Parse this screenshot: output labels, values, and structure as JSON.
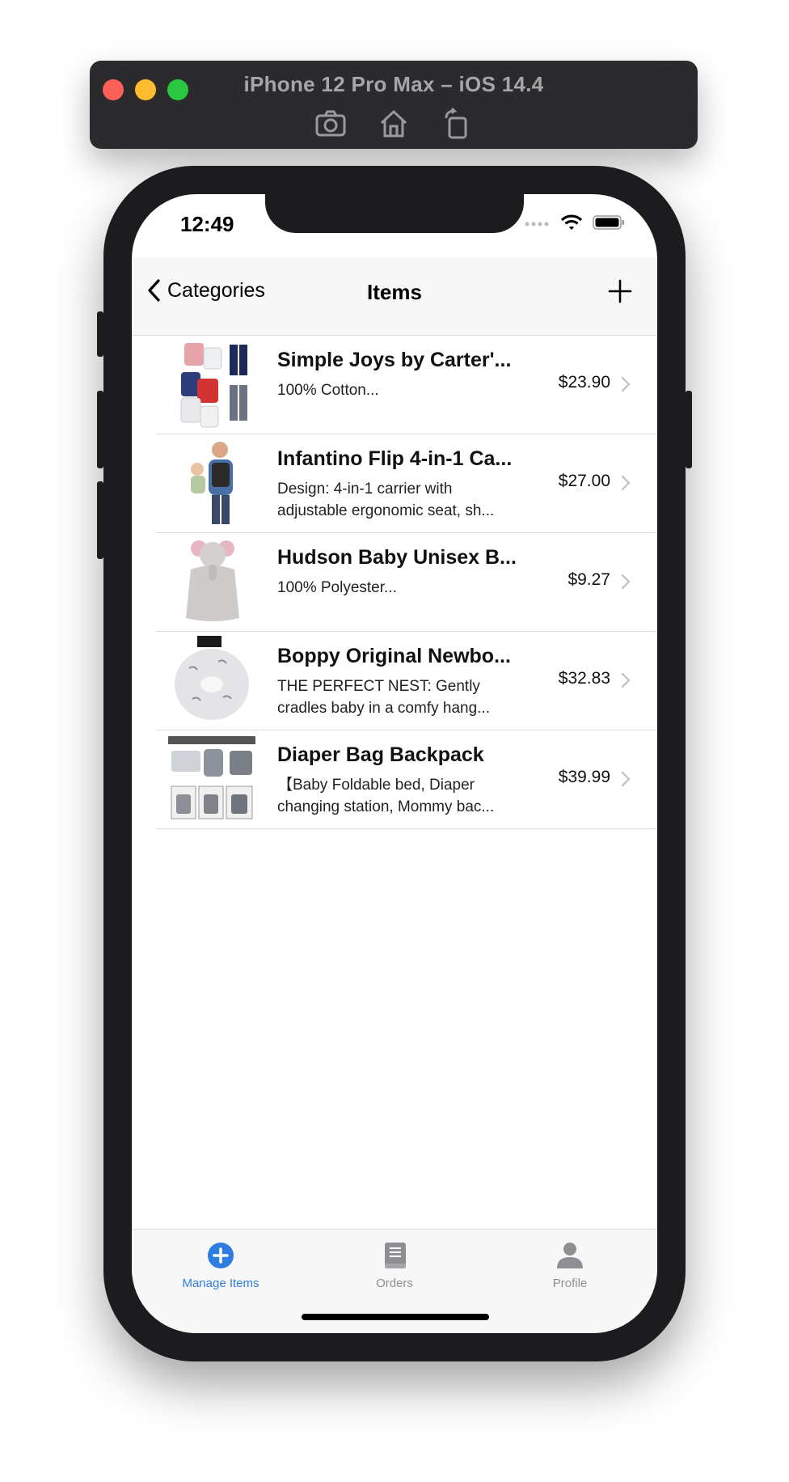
{
  "simulator": {
    "title": "iPhone 12 Pro Max – iOS 14.4",
    "tools": [
      {
        "icon": "screenshot-icon"
      },
      {
        "icon": "home-icon"
      },
      {
        "icon": "rotate-icon"
      }
    ]
  },
  "status_bar": {
    "time": "12:49"
  },
  "nav": {
    "back_label": "Categories",
    "title": "Items",
    "add_icon": "plus-icon"
  },
  "items": [
    {
      "title": "Simple Joys by Carter'...",
      "subtitle": "100% Cotton...",
      "price": "$23.90"
    },
    {
      "title": "Infantino Flip 4-in-1 Ca...",
      "subtitle": "Design: 4-in-1 carrier with adjustable ergonomic seat, sh...",
      "price": "$27.00"
    },
    {
      "title": "Hudson Baby Unisex B...",
      "subtitle": "100% Polyester...",
      "price": "$9.27"
    },
    {
      "title": "Boppy Original Newbo...",
      "subtitle": "THE PERFECT NEST: Gently cradles baby in a comfy hang...",
      "price": "$32.83"
    },
    {
      "title": "Diaper Bag Backpack",
      "subtitle": "【Baby Foldable bed, Diaper changing station, Mommy bac...",
      "price": "$39.99"
    }
  ],
  "tabs": [
    {
      "label": "Manage Items",
      "icon": "plus-circle-icon",
      "active": true
    },
    {
      "label": "Orders",
      "icon": "document-icon",
      "active": false
    },
    {
      "label": "Profile",
      "icon": "person-icon",
      "active": false
    }
  ],
  "colors": {
    "accent": "#2f7de1",
    "inactive_tab": "#8e8e93"
  }
}
